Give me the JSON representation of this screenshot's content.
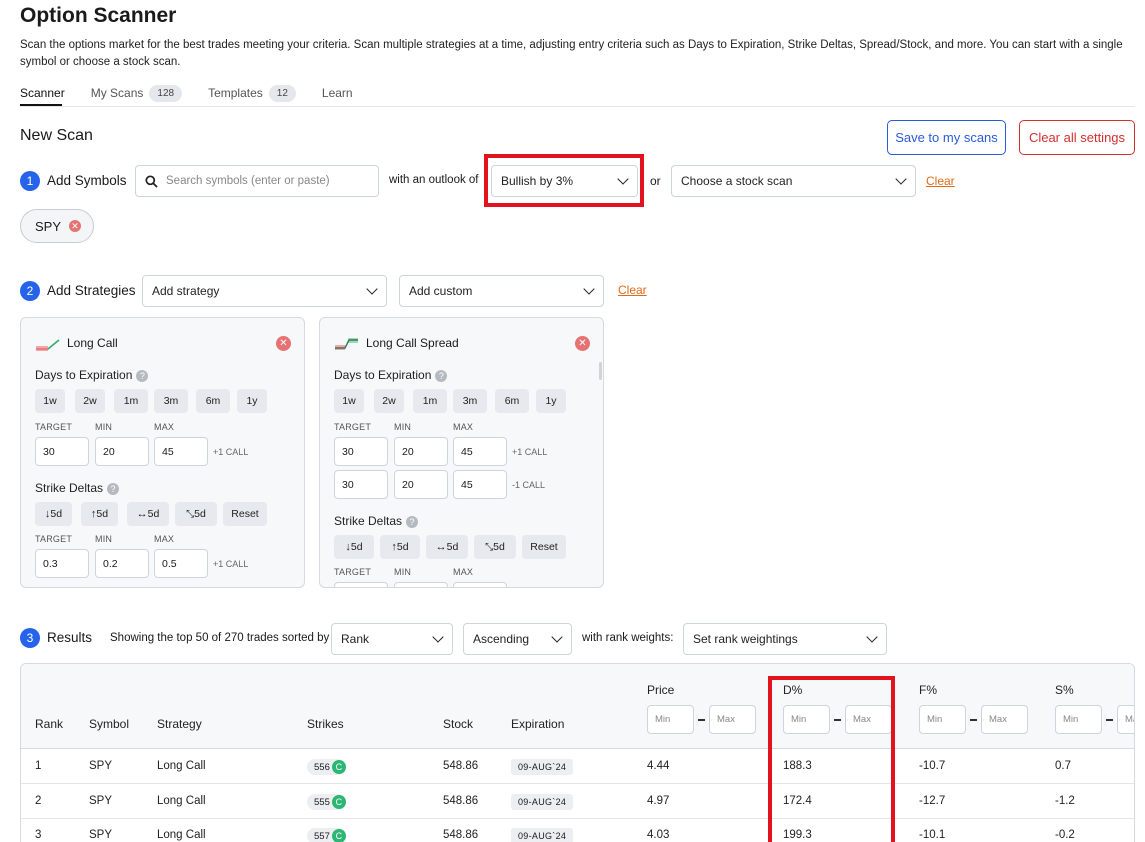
{
  "page": {
    "title": "Option Scanner",
    "description": "Scan the options market for the best trades meeting your criteria. Scan multiple strategies at a time, adjusting entry criteria such as Days to Expiration, Strike Deltas, Spread/Stock, and more. You can start with a single symbol or choose a stock scan."
  },
  "tabs": [
    {
      "label": "Scanner",
      "badge": ""
    },
    {
      "label": "My Scans",
      "badge": "128"
    },
    {
      "label": "Templates",
      "badge": "12"
    },
    {
      "label": "Learn",
      "badge": ""
    }
  ],
  "new_scan": {
    "title": "New Scan",
    "save_label": "Save to my scans",
    "clear_all_label": "Clear all settings"
  },
  "step1": {
    "num": "1",
    "label": "Add Symbols",
    "search_placeholder": "Search symbols (enter or paste)",
    "outlook_prefix": "with an outlook of",
    "outlook_value": "Bullish by 3%",
    "or": "or",
    "stock_scan_value": "Choose a stock scan",
    "clear": "Clear",
    "chip": "SPY"
  },
  "step2": {
    "num": "2",
    "label": "Add Strategies",
    "add_strategy": "Add strategy",
    "add_custom": "Add custom",
    "clear": "Clear",
    "cards": [
      {
        "title": "Long Call",
        "dte_label": "Days to Expiration",
        "dte_pills": [
          "1w",
          "2w",
          "1m",
          "3m",
          "6m",
          "1y"
        ],
        "col_target": "TARGET",
        "col_min": "MIN",
        "col_max": "MAX",
        "dte_rows": [
          {
            "target": "30",
            "min": "20",
            "max": "45",
            "leg": "+1 CALL"
          }
        ],
        "delta_label": "Strike Deltas",
        "delta_pills": [
          "5d",
          "5d",
          "5d",
          "5d",
          "Reset"
        ],
        "delta_rows": [
          {
            "target": "0.3",
            "min": "0.2",
            "max": "0.5",
            "leg": "+1 CALL"
          }
        ]
      },
      {
        "title": "Long Call Spread",
        "dte_label": "Days to Expiration",
        "dte_pills": [
          "1w",
          "2w",
          "1m",
          "3m",
          "6m",
          "1y"
        ],
        "col_target": "TARGET",
        "col_min": "MIN",
        "col_max": "MAX",
        "dte_rows": [
          {
            "target": "30",
            "min": "20",
            "max": "45",
            "leg": "+1 CALL"
          },
          {
            "target": "30",
            "min": "20",
            "max": "45",
            "leg": "-1 CALL"
          }
        ],
        "delta_label": "Strike Deltas",
        "delta_pills": [
          "5d",
          "5d",
          "5d",
          "5d",
          "Reset"
        ]
      }
    ]
  },
  "step3": {
    "num": "3",
    "label": "Results",
    "summary": "Showing the top 50 of 270 trades sorted by",
    "sort_by": "Rank",
    "order": "Ascending",
    "weights_prefix": "with rank weights:",
    "weights_value": "Set rank weightings"
  },
  "table": {
    "headers": {
      "rank": "Rank",
      "symbol": "Symbol",
      "strategy": "Strategy",
      "strikes": "Strikes",
      "stock": "Stock",
      "expiration": "Expiration",
      "price": "Price",
      "d": "D%",
      "f": "F%",
      "s": "S%"
    },
    "min_placeholder": "Min",
    "max_placeholder": "Max",
    "rows": [
      {
        "rank": "1",
        "symbol": "SPY",
        "strategy": "Long Call",
        "strike": "556",
        "cp": "C",
        "stock": "548.86",
        "expiration": "09-AUG`24",
        "price": "4.44",
        "d": "188.3",
        "f": "-10.7",
        "s": "0.7"
      },
      {
        "rank": "2",
        "symbol": "SPY",
        "strategy": "Long Call",
        "strike": "555",
        "cp": "C",
        "stock": "548.86",
        "expiration": "09-AUG`24",
        "price": "4.97",
        "d": "172.4",
        "f": "-12.7",
        "s": "-1.2"
      },
      {
        "rank": "3",
        "symbol": "SPY",
        "strategy": "Long Call",
        "strike": "557",
        "cp": "C",
        "stock": "548.86",
        "expiration": "09-AUG`24",
        "price": "4.03",
        "d": "199.3",
        "f": "-10.1",
        "s": "-0.2"
      }
    ]
  },
  "colors": {
    "accent": "#2563eb",
    "danger": "#d32f2f",
    "highlight": "#e3121f",
    "call_badge": "#2bb673",
    "clear_link": "#e06a1a"
  }
}
